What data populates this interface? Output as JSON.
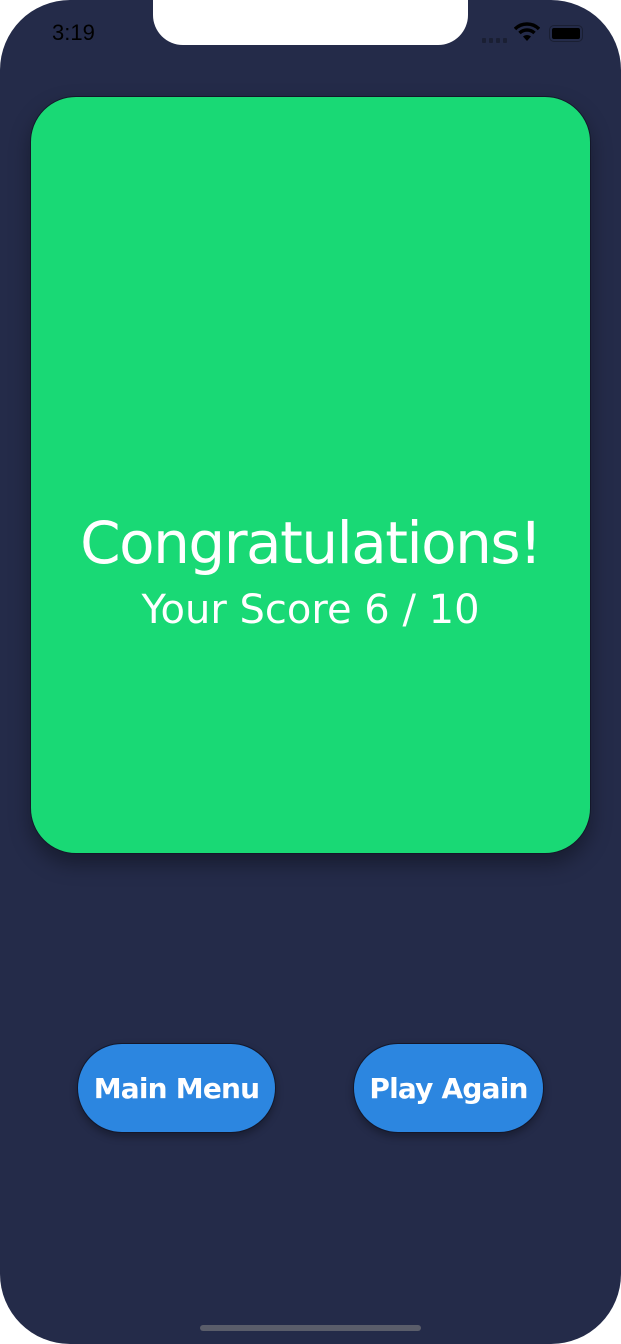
{
  "status_bar": {
    "time": "3:19",
    "icons": [
      "signal-icon",
      "wifi-icon",
      "battery-icon"
    ]
  },
  "result_card": {
    "title": "Congratulations!",
    "score_text": "Your Score 6 / 10",
    "color": "#19d975"
  },
  "buttons": {
    "main_menu": "Main Menu",
    "play_again": "Play Again",
    "color": "#2c86e0"
  },
  "background_color": "#242b49"
}
